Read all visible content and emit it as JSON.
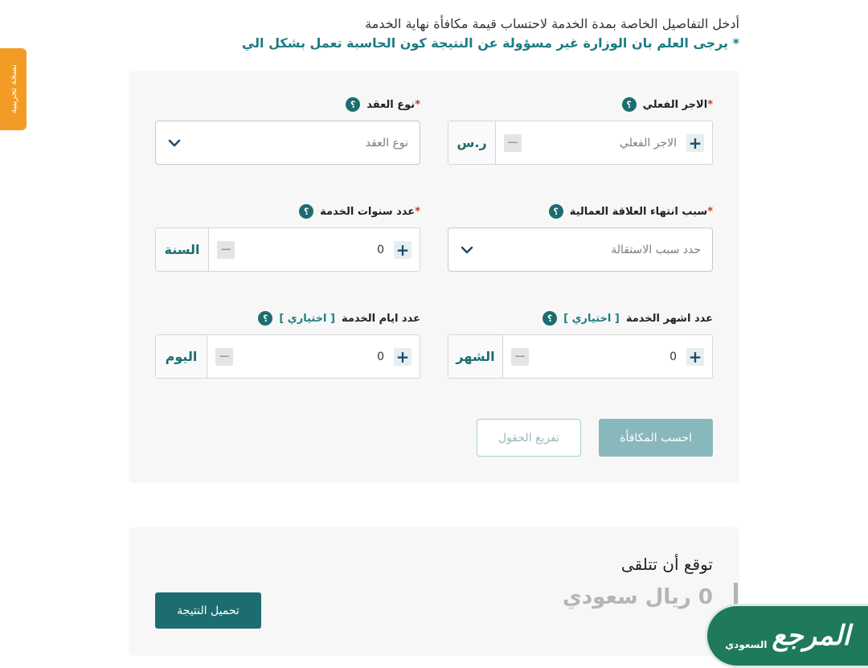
{
  "intro": {
    "line1": "أدخل التفاصيل الخاصة بمدة الخدمة لاحتساب قيمة مكافأة نهاية الخدمة",
    "line2": "* يرجى العلم بان الوزارة غير مسؤولة عن النتيجة كون الحاسبة تعمل بشكل الي"
  },
  "side_tab": {
    "label": "نسخة تجريبية",
    "color": "#f39c25"
  },
  "help_glyph": "؟",
  "form": {
    "actual_wage": {
      "label": "الاجر الفعلي",
      "required": "*",
      "placeholder": "الاجر الفعلي",
      "unit": "ر.س"
    },
    "contract_type": {
      "label": "نوع العقد",
      "required": "*",
      "placeholder": "نوع العقد"
    },
    "termination_reason": {
      "label": "سبب انتهاء العلاقة العمالية",
      "required": "*",
      "placeholder": "حدد سبب الاستقالة"
    },
    "service_years": {
      "label": "عدد سنوات الخدمة",
      "required": "*",
      "value": "0",
      "unit": "السنة"
    },
    "service_months": {
      "label": "عدد اشهر الخدمة",
      "optional": "[ اختياري ]",
      "value": "0",
      "unit": "الشهر"
    },
    "service_days": {
      "label": "عدد ايام الخدمة",
      "optional": "[ اختياري ]",
      "value": "0",
      "unit": "اليوم"
    },
    "calculate_label": "احسب المكافأة",
    "clear_label": "تفريغ الحقول"
  },
  "result": {
    "title": "توقع أن تتلقى",
    "value": "0 ريال سعودي",
    "download_label": "تحميل النتيجة"
  },
  "logo": {
    "big": "المرجع",
    "small": "السعودي"
  },
  "colors": {
    "accent": "#1d6d70",
    "accent_light": "#89b8bc",
    "logo_bg": "#1e7a58"
  }
}
